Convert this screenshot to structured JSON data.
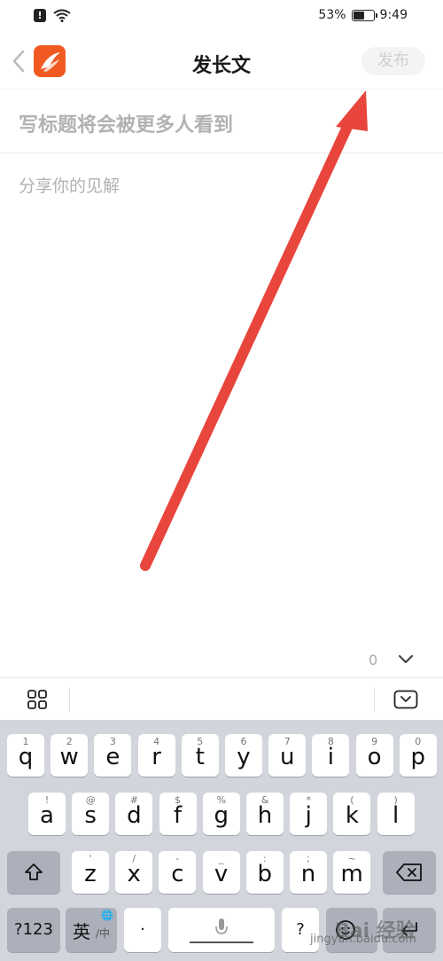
{
  "status_bar": {
    "battery_text": "53%",
    "battery_level": 0.53,
    "time": "9:49",
    "icons": [
      "alert-icon",
      "wifi-icon",
      "battery-icon"
    ]
  },
  "header": {
    "title": "发长文",
    "publish_label": "发布",
    "icons": [
      "back-chevron-icon",
      "app-logo"
    ]
  },
  "editor": {
    "title_placeholder": "写标题将会被更多人看到",
    "body_placeholder": "分享你的见解",
    "word_count": "0"
  },
  "colors": {
    "brand": "#f05a22",
    "annotation_arrow": "#e8453c",
    "keyboard_bg": "#d2d5dc"
  },
  "keyboard": {
    "row1": [
      {
        "hint": "1",
        "key": "q"
      },
      {
        "hint": "2",
        "key": "w"
      },
      {
        "hint": "3",
        "key": "e"
      },
      {
        "hint": "4",
        "key": "r"
      },
      {
        "hint": "5",
        "key": "t"
      },
      {
        "hint": "6",
        "key": "y"
      },
      {
        "hint": "7",
        "key": "u"
      },
      {
        "hint": "8",
        "key": "i"
      },
      {
        "hint": "9",
        "key": "o"
      },
      {
        "hint": "0",
        "key": "p"
      }
    ],
    "row2": [
      {
        "hint": "!",
        "key": "a"
      },
      {
        "hint": "@",
        "key": "s"
      },
      {
        "hint": "#",
        "key": "d"
      },
      {
        "hint": "$",
        "key": "f"
      },
      {
        "hint": "%",
        "key": "g"
      },
      {
        "hint": "&",
        "key": "h"
      },
      {
        "hint": "*",
        "key": "j"
      },
      {
        "hint": "(",
        "key": "k"
      },
      {
        "hint": ")",
        "key": "l"
      }
    ],
    "row3": [
      {
        "hint": "'",
        "key": "z"
      },
      {
        "hint": "/",
        "key": "x"
      },
      {
        "hint": "-",
        "key": "c"
      },
      {
        "hint": "_",
        "key": "v"
      },
      {
        "hint": ":",
        "key": "b"
      },
      {
        "hint": ";",
        "key": "n"
      },
      {
        "hint": "~",
        "key": "m"
      }
    ],
    "symbols_key": "?123",
    "lang_key_main": "英",
    "lang_key_sub": "/中",
    "lang_key_globe": "🌐",
    "period_key": "·",
    "question_key": "?",
    "watermark_text": "jingyan.baidu.com",
    "watermark_brand": "Bai 经验"
  }
}
